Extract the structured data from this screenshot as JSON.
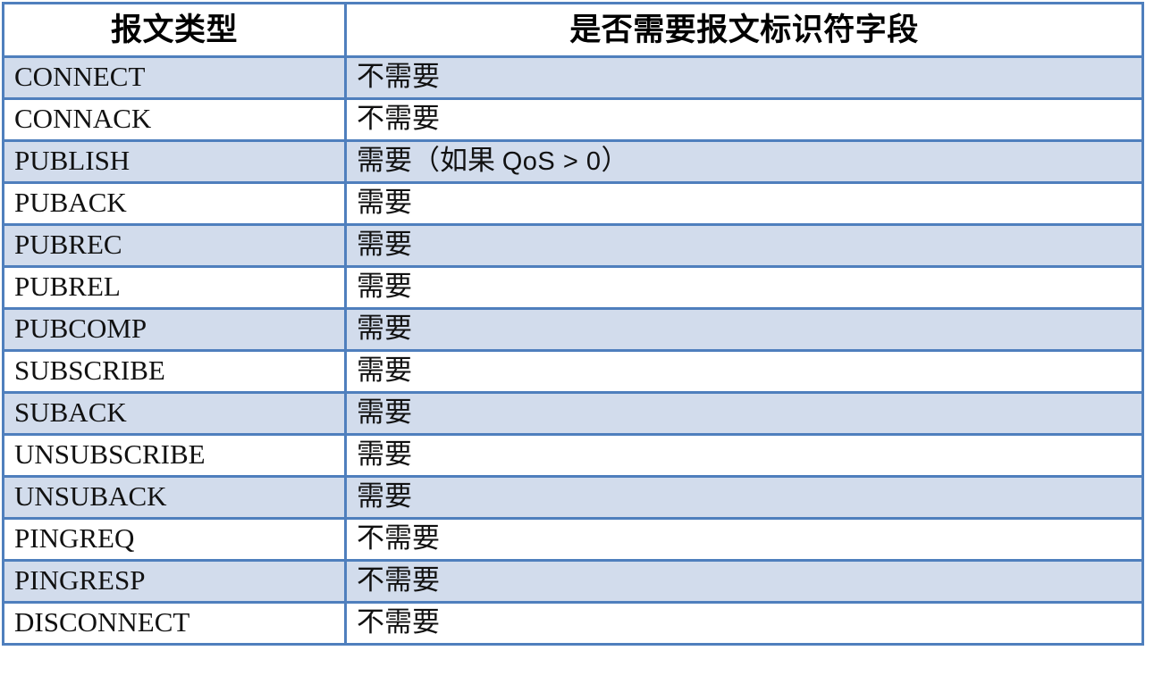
{
  "table": {
    "columns": [
      {
        "key": "packet_type",
        "label": "报文类型",
        "align": "center"
      },
      {
        "key": "needs_identifier",
        "label": "是否需要报文标识符字段",
        "align": "center"
      }
    ],
    "rows": [
      {
        "packet_type": "CONNECT",
        "needs_identifier": "不需要",
        "shaded": true
      },
      {
        "packet_type": "CONNACK",
        "needs_identifier": "不需要",
        "shaded": false
      },
      {
        "packet_type": "PUBLISH",
        "needs_identifier": "需要（如果 QoS > 0）",
        "needs_prefix": "需要（如果 ",
        "needs_latin": "QoS > 0",
        "needs_suffix": "）",
        "shaded": true
      },
      {
        "packet_type": "PUBACK",
        "needs_identifier": "需要",
        "shaded": false
      },
      {
        "packet_type": "PUBREC",
        "needs_identifier": "需要",
        "shaded": true
      },
      {
        "packet_type": "PUBREL",
        "needs_identifier": "需要",
        "shaded": false
      },
      {
        "packet_type": "PUBCOMP",
        "needs_identifier": "需要",
        "shaded": true
      },
      {
        "packet_type": "SUBSCRIBE",
        "needs_identifier": "需要",
        "shaded": false
      },
      {
        "packet_type": "SUBACK",
        "needs_identifier": "需要",
        "shaded": true
      },
      {
        "packet_type": "UNSUBSCRIBE",
        "needs_identifier": "需要",
        "shaded": false
      },
      {
        "packet_type": "UNSUBACK",
        "needs_identifier": "需要",
        "shaded": true
      },
      {
        "packet_type": "PINGREQ",
        "needs_identifier": "不需要",
        "shaded": false
      },
      {
        "packet_type": "PINGRESP",
        "needs_identifier": "不需要",
        "shaded": true
      },
      {
        "packet_type": "DISCONNECT",
        "needs_identifier": "不需要",
        "shaded": false
      }
    ]
  },
  "colors": {
    "border": "#4f7fbd",
    "row_shaded": "#d2dcec",
    "row_plain": "#ffffff",
    "text": "#111111",
    "header_text": "#000000",
    "page_background": "#ffffff"
  }
}
